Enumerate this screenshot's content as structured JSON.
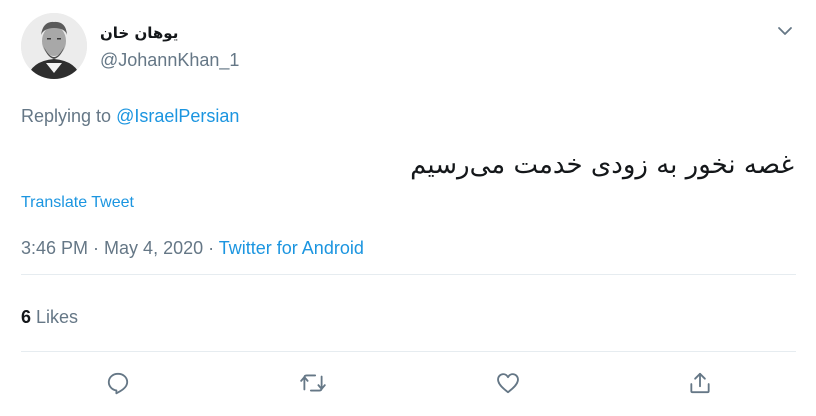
{
  "author": {
    "display_name": "یوهان خان",
    "handle": "@JohannKhan_1"
  },
  "reply": {
    "prefix": "Replying to ",
    "mention": "@IsraelPersian"
  },
  "tweet": {
    "text": "غصه نخور به زودی خدمت می‌رسیم",
    "translate_label": "Translate Tweet",
    "time": "3:46 PM",
    "date": "May 4, 2020",
    "separator": " · ",
    "source": "Twitter for Android"
  },
  "stats": {
    "likes_count": "6",
    "likes_label": " Likes"
  },
  "icons": {
    "menu": "chevron-down-icon",
    "reply": "reply-icon",
    "retweet": "retweet-icon",
    "like": "heart-icon",
    "share": "share-icon"
  },
  "colors": {
    "link": "#1b95e0",
    "secondary_text": "#657786",
    "primary_text": "#14171a",
    "divider": "#e6ecf0"
  }
}
